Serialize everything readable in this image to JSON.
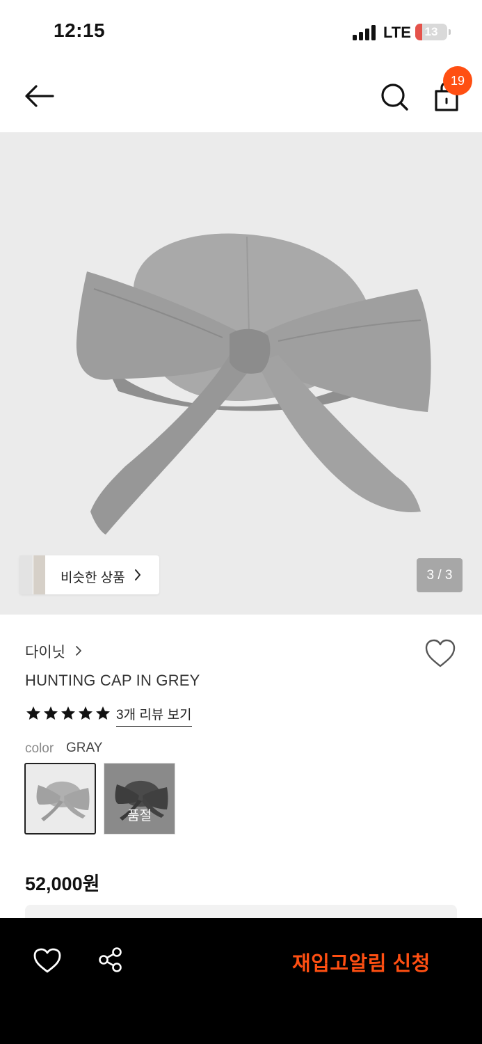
{
  "status_bar": {
    "time": "12:15",
    "network": "LTE",
    "battery_level": "13"
  },
  "header": {
    "back_icon": "arrow-left-icon",
    "search_icon": "search-icon",
    "cart_icon": "shopping-bag-icon",
    "cart_count": "19"
  },
  "gallery": {
    "similar_label": "비슷한 상품",
    "page_counter": "3 / 3",
    "background_color": "#ebebeb"
  },
  "product": {
    "brand": "다이닛",
    "name": "HUNTING CAP IN GREY",
    "rating": 5,
    "review_link": "3개 리뷰 보기",
    "color_label": "color",
    "color_value": "GRAY",
    "swatches": [
      {
        "state": "selected",
        "status": ""
      },
      {
        "state": "sold-out",
        "status": "품절"
      }
    ],
    "price": "52,000원"
  },
  "bottom_bar": {
    "wish_icon": "heart-outline-icon",
    "share_icon": "share-icon",
    "restock_label": "재입고알림 신청",
    "accent_color": "#ff4f12"
  }
}
